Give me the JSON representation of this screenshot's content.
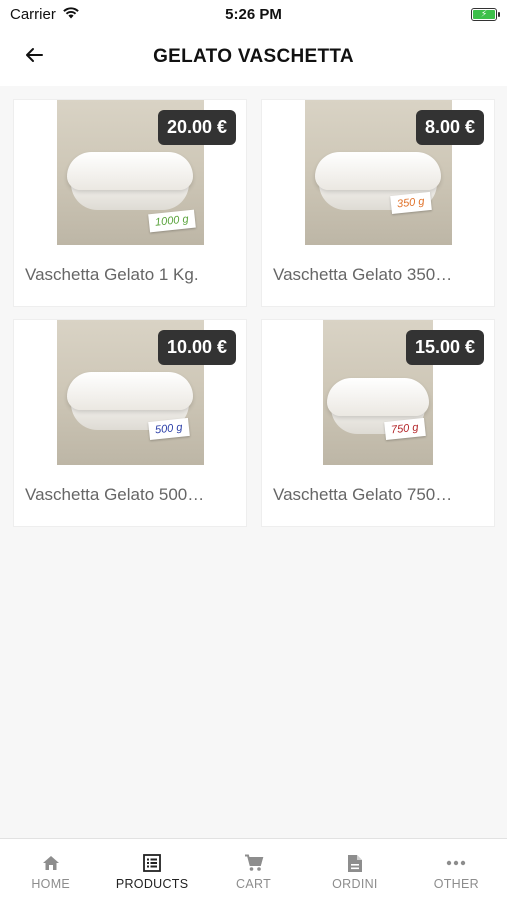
{
  "status": {
    "carrier": "Carrier",
    "time": "5:26 PM"
  },
  "header": {
    "title": "GELATO VASCHETTA",
    "back_icon": "arrow-left-icon"
  },
  "products": [
    {
      "title": "Vaschetta Gelato 1 Kg.",
      "price": "20.00 €",
      "tag": "1000 g",
      "tag_color": "#5aa33c"
    },
    {
      "title": "Vaschetta Gelato 350…",
      "price": "8.00 €",
      "tag": "350 g",
      "tag_color": "#e0722a"
    },
    {
      "title": "Vaschetta Gelato 500…",
      "price": "10.00 €",
      "tag": "500 g",
      "tag_color": "#2b3fa8"
    },
    {
      "title": "Vaschetta Gelato 750…",
      "price": "15.00 €",
      "tag": "750 g",
      "tag_color": "#b3262a"
    }
  ],
  "tabs": [
    {
      "label": "HOME",
      "icon": "home-icon",
      "active": false
    },
    {
      "label": "PRODUCTS",
      "icon": "list-icon",
      "active": true
    },
    {
      "label": "CART",
      "icon": "cart-icon",
      "active": false
    },
    {
      "label": "ORDINI",
      "icon": "document-icon",
      "active": false
    },
    {
      "label": "OTHER",
      "icon": "more-icon",
      "active": false
    }
  ],
  "colors": {
    "price_badge": "#333333",
    "tab_active": "#222222",
    "tab_inactive": "#8d8d8d",
    "battery": "#3cc04a"
  }
}
